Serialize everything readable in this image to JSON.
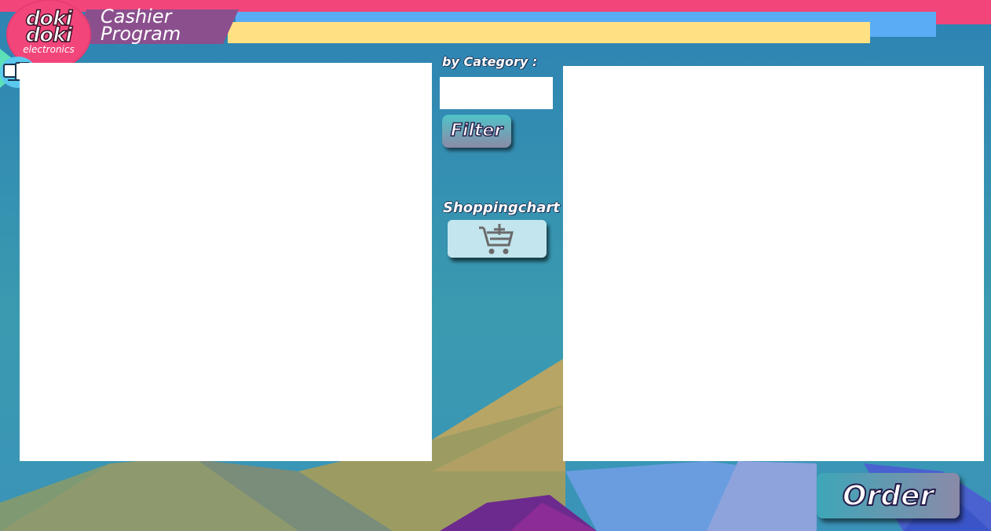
{
  "app": {
    "logo_line1": "doki",
    "logo_line2": "doki",
    "logo_line3": "electronics",
    "title_line1": "Cashier",
    "title_line2": "Program"
  },
  "filter": {
    "category_label": "by Category :",
    "category_value": "",
    "button_label": "Filter"
  },
  "cart": {
    "label": "Shoppingchart",
    "icon": "cart-plus-icon"
  },
  "order": {
    "button_label": "Order"
  },
  "colors": {
    "background": "#2f86b6",
    "stripe_pink": "#f2467b",
    "stripe_blue": "#5aacf4",
    "stripe_yellow": "#ffe183",
    "title_banner": "#8b4f8e",
    "panel": "#ffffff"
  }
}
